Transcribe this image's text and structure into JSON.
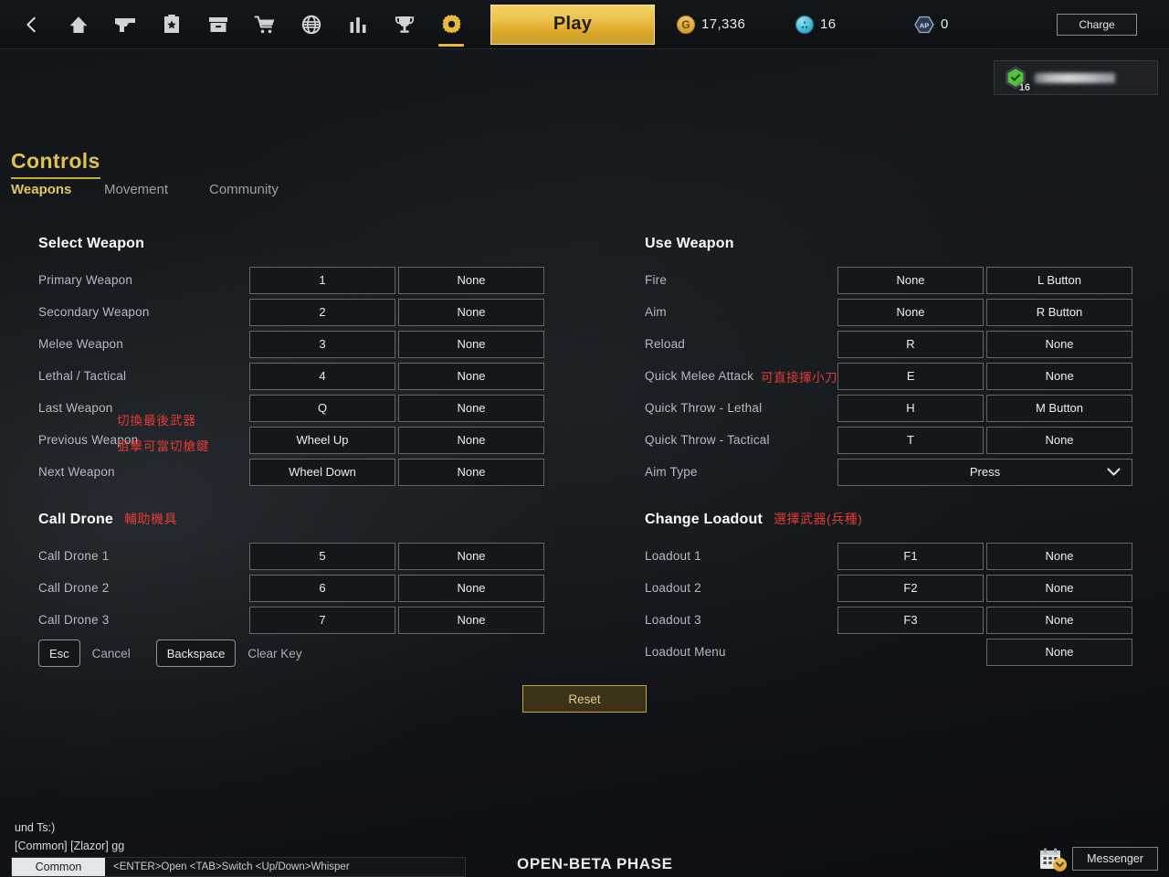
{
  "topbar": {
    "nav_icons": [
      {
        "name": "back-arrow-icon",
        "label": "Back"
      },
      {
        "name": "home-icon",
        "label": "Home"
      },
      {
        "name": "weapon-pistol-icon",
        "label": "Weapons"
      },
      {
        "name": "star-box-icon",
        "label": "Rewards"
      },
      {
        "name": "inventory-box-icon",
        "label": "Inventory"
      },
      {
        "name": "shopping-cart-icon",
        "label": "Store"
      },
      {
        "name": "globe-icon",
        "label": "World"
      },
      {
        "name": "bar-chart-icon",
        "label": "Stats"
      },
      {
        "name": "trophy-icon",
        "label": "Ranking"
      },
      {
        "name": "gear-icon",
        "label": "Settings"
      }
    ],
    "play_label": "Play",
    "currencies": [
      {
        "icon": "gold-coin-icon",
        "symbol": "G",
        "value": "17,336"
      },
      {
        "icon": "blue-token-icon",
        "symbol": "",
        "value": "16"
      },
      {
        "icon": "ap-hex-icon",
        "symbol": "AP",
        "value": "0"
      }
    ],
    "charge_label": "Charge"
  },
  "player_card": {
    "rank_level": "16",
    "name_hidden": true
  },
  "page": {
    "title": "Controls",
    "tabs": [
      {
        "label": "Weapons",
        "active": true
      },
      {
        "label": "Movement",
        "active": false
      },
      {
        "label": "Community",
        "active": false
      }
    ]
  },
  "sections": {
    "select_weapon": {
      "heading": "Select Weapon",
      "note": "",
      "rows": [
        {
          "label": "Primary Weapon",
          "note": "",
          "binds": [
            "1",
            "None"
          ]
        },
        {
          "label": "Secondary Weapon",
          "note": "",
          "binds": [
            "2",
            "None"
          ]
        },
        {
          "label": "Melee Weapon",
          "note": "",
          "binds": [
            "3",
            "None"
          ]
        },
        {
          "label": "Lethal / Tactical",
          "note": "",
          "binds": [
            "4",
            "None"
          ]
        },
        {
          "label": "Last Weapon",
          "note": "",
          "binds": [
            "Q",
            "None"
          ]
        },
        {
          "label": "Previous Weapon",
          "note": "",
          "binds": [
            "Wheel Up",
            "None"
          ]
        },
        {
          "label": "Next Weapon",
          "note": "",
          "binds": [
            "Wheel Down",
            "None"
          ]
        }
      ],
      "annotations": [
        "切換最後武器",
        "狙擊可當切槍鍵"
      ]
    },
    "call_drone": {
      "heading": "Call Drone",
      "note": "輔助機具",
      "rows": [
        {
          "label": "Call Drone 1",
          "binds": [
            "5",
            "None"
          ]
        },
        {
          "label": "Call Drone 2",
          "binds": [
            "6",
            "None"
          ]
        },
        {
          "label": "Call Drone 3",
          "binds": [
            "7",
            "None"
          ]
        }
      ]
    },
    "use_weapon": {
      "heading": "Use Weapon",
      "note": "",
      "rows": [
        {
          "label": "Fire",
          "note": "",
          "binds": [
            "None",
            "L Button"
          ]
        },
        {
          "label": "Aim",
          "note": "",
          "binds": [
            "None",
            "R Button"
          ]
        },
        {
          "label": "Reload",
          "note": "",
          "binds": [
            "R",
            "None"
          ]
        },
        {
          "label": "Quick Melee Attack",
          "note": "可直接揮小刀",
          "binds": [
            "E",
            "None"
          ]
        },
        {
          "label": "Quick Throw - Lethal",
          "note": "",
          "binds": [
            "H",
            "M Button"
          ]
        },
        {
          "label": "Quick Throw - Tactical",
          "note": "",
          "binds": [
            "T",
            "None"
          ]
        }
      ],
      "dropdown_row": {
        "label": "Aim Type",
        "value": "Press"
      }
    },
    "change_loadout": {
      "heading": "Change Loadout",
      "note": "選擇武器(兵種)",
      "rows": [
        {
          "label": "Loadout 1",
          "binds": [
            "F1",
            "None"
          ]
        },
        {
          "label": "Loadout 2",
          "binds": [
            "F2",
            "None"
          ]
        },
        {
          "label": "Loadout 3",
          "binds": [
            "F3",
            "None"
          ]
        }
      ],
      "single_row": {
        "label": "Loadout Menu",
        "bind": "None"
      }
    }
  },
  "legend": {
    "esc_key": "Esc",
    "esc_action": "Cancel",
    "backspace_key": "Backspace",
    "backspace_action": "Clear Key"
  },
  "reset_label": "Reset",
  "chat": {
    "lines": [
      "und Ts:)",
      "[Common] [Zlazor]  gg"
    ],
    "channel": "Common",
    "hint": "<ENTER>Open <TAB>Switch <Up/Down>Whisper"
  },
  "footer": {
    "beta_label": "OPEN-BETA PHASE",
    "calendar_icon": "calendar-icon",
    "messenger_label": "Messenger"
  },
  "colors": {
    "accent_gold": "#e0c24f",
    "play_gold": "#ecc04a",
    "annotation_red": "#e23b33",
    "bind_bg": "#15181b",
    "bind_border": "#62686f"
  }
}
